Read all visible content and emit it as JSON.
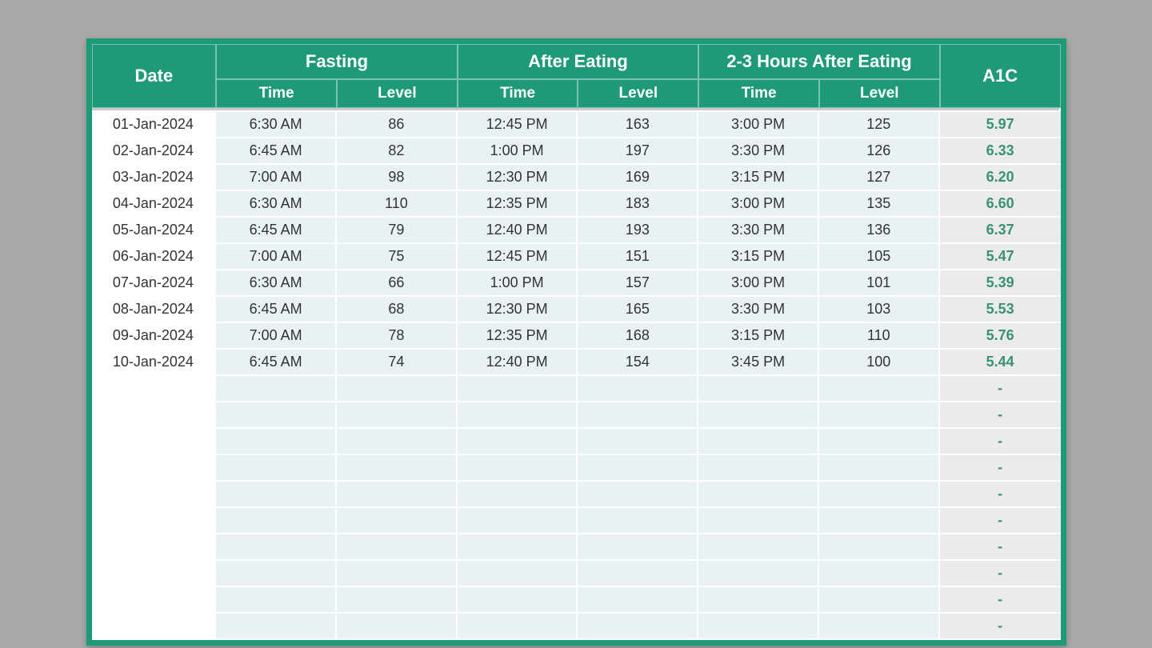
{
  "headers": {
    "date": "Date",
    "groups": [
      "Fasting",
      "After Eating",
      "2-3 Hours After Eating"
    ],
    "sub_time": "Time",
    "sub_level": "Level",
    "a1c": "A1C"
  },
  "rows": [
    {
      "date": "01-Jan-2024",
      "fasting_time": "6:30 AM",
      "fasting_level": "86",
      "after_time": "12:45 PM",
      "after_level": "163",
      "post_time": "3:00 PM",
      "post_level": "125",
      "a1c": "5.97"
    },
    {
      "date": "02-Jan-2024",
      "fasting_time": "6:45 AM",
      "fasting_level": "82",
      "after_time": "1:00 PM",
      "after_level": "197",
      "post_time": "3:30 PM",
      "post_level": "126",
      "a1c": "6.33"
    },
    {
      "date": "03-Jan-2024",
      "fasting_time": "7:00 AM",
      "fasting_level": "98",
      "after_time": "12:30 PM",
      "after_level": "169",
      "post_time": "3:15 PM",
      "post_level": "127",
      "a1c": "6.20"
    },
    {
      "date": "04-Jan-2024",
      "fasting_time": "6:30 AM",
      "fasting_level": "110",
      "after_time": "12:35 PM",
      "after_level": "183",
      "post_time": "3:00 PM",
      "post_level": "135",
      "a1c": "6.60"
    },
    {
      "date": "05-Jan-2024",
      "fasting_time": "6:45 AM",
      "fasting_level": "79",
      "after_time": "12:40 PM",
      "after_level": "193",
      "post_time": "3:30 PM",
      "post_level": "136",
      "a1c": "6.37"
    },
    {
      "date": "06-Jan-2024",
      "fasting_time": "7:00 AM",
      "fasting_level": "75",
      "after_time": "12:45 PM",
      "after_level": "151",
      "post_time": "3:15 PM",
      "post_level": "105",
      "a1c": "5.47"
    },
    {
      "date": "07-Jan-2024",
      "fasting_time": "6:30 AM",
      "fasting_level": "66",
      "after_time": "1:00 PM",
      "after_level": "157",
      "post_time": "3:00 PM",
      "post_level": "101",
      "a1c": "5.39"
    },
    {
      "date": "08-Jan-2024",
      "fasting_time": "6:45 AM",
      "fasting_level": "68",
      "after_time": "12:30 PM",
      "after_level": "165",
      "post_time": "3:30 PM",
      "post_level": "103",
      "a1c": "5.53"
    },
    {
      "date": "09-Jan-2024",
      "fasting_time": "7:00 AM",
      "fasting_level": "78",
      "after_time": "12:35 PM",
      "after_level": "168",
      "post_time": "3:15 PM",
      "post_level": "110",
      "a1c": "5.76"
    },
    {
      "date": "10-Jan-2024",
      "fasting_time": "6:45 AM",
      "fasting_level": "74",
      "after_time": "12:40 PM",
      "after_level": "154",
      "post_time": "3:45 PM",
      "post_level": "100",
      "a1c": "5.44"
    }
  ],
  "empty_rows": 10,
  "empty_a1c": "-"
}
